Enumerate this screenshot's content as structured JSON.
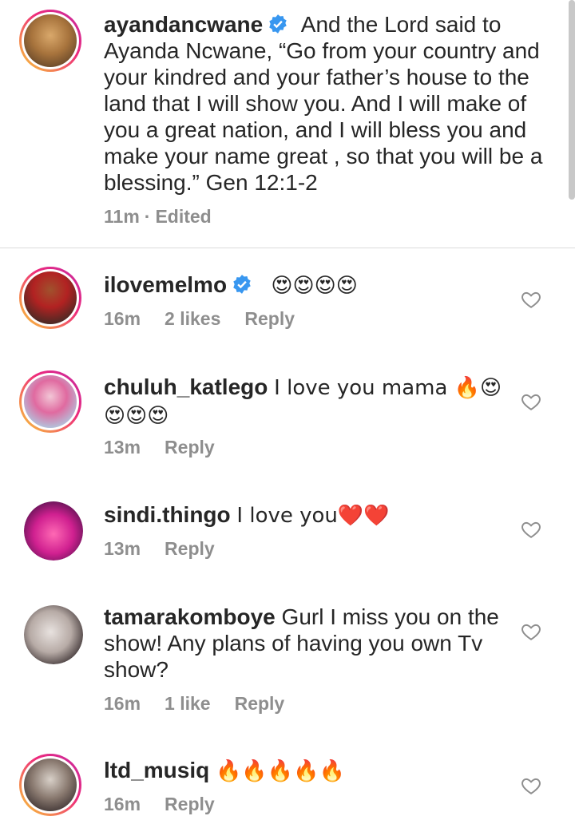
{
  "caption": {
    "username": "ayandancwane",
    "text_line1": "And the Lord said to",
    "text_rest": "Ayanda Ncwane, “Go from your country and your kindred and your father’s house to the land that I will show you. And I will make of you a great nation, and I will bless you and make your name great , so that you will be a blessing.” Gen 12:1-2",
    "time": "11m",
    "separator": "·",
    "edited": "Edited"
  },
  "comments": [
    {
      "username": "ilovemelmo",
      "verified": true,
      "text": "😍😍😍😍",
      "time": "16m",
      "likes": "2 likes",
      "reply": "Reply"
    },
    {
      "username": "chuluh_katlego",
      "verified": false,
      "text": "I love you mama 🔥😍",
      "text2": "😍😍😍",
      "time": "13m",
      "likes": "",
      "reply": "Reply"
    },
    {
      "username": "sindi.thingo",
      "verified": false,
      "text": "I love you❤️❤️",
      "time": "13m",
      "likes": "",
      "reply": "Reply"
    },
    {
      "username": "tamarakomboye",
      "verified": false,
      "text": "Gurl I miss you on the show! Any plans of having you own Tv show?",
      "time": "16m",
      "likes": "1 like",
      "reply": "Reply"
    },
    {
      "username": "ltd_musiq",
      "verified": false,
      "text": "🔥🔥🔥🔥🔥",
      "time": "16m",
      "likes": "",
      "reply": "Reply"
    }
  ],
  "icons": {
    "verified": "verified-badge-icon",
    "like": "heart-outline-icon"
  },
  "colors": {
    "verified_blue": "#3897f0",
    "meta_gray": "#8e8e8e",
    "text": "#262626"
  }
}
